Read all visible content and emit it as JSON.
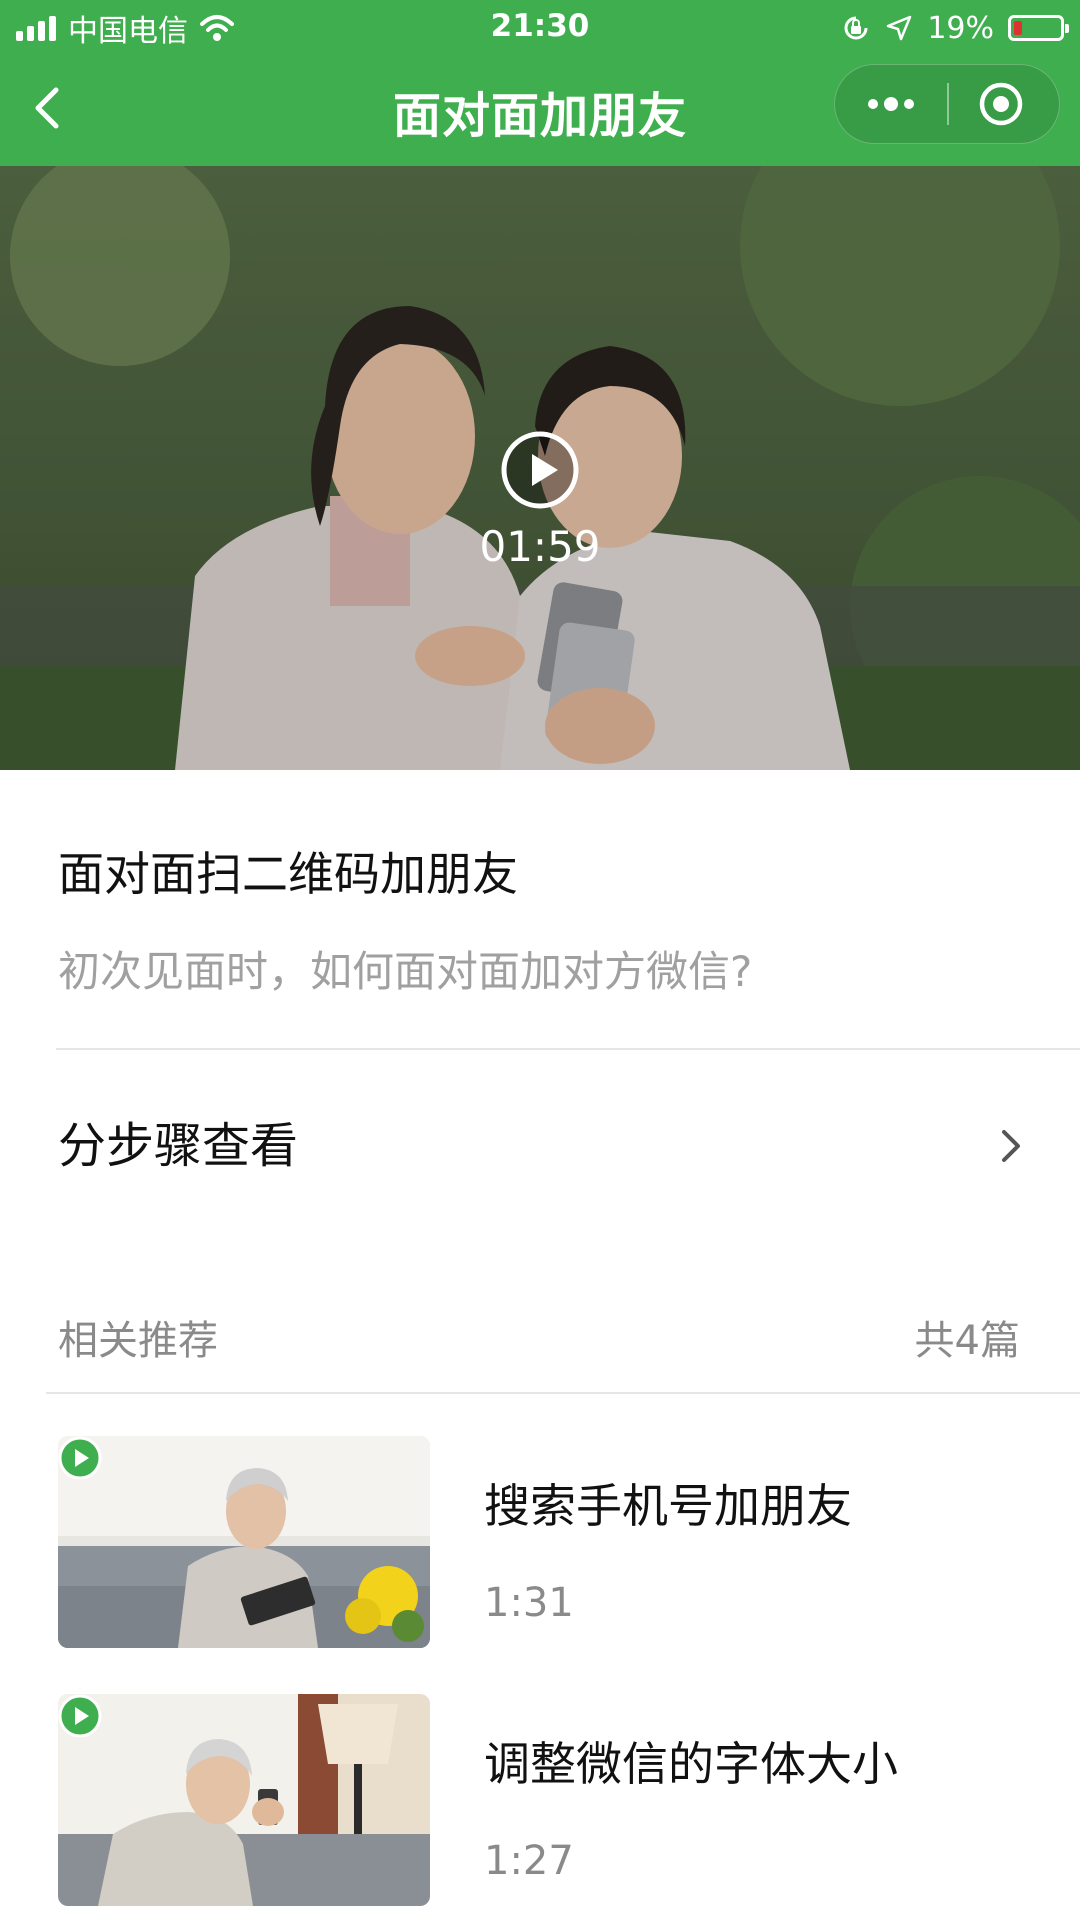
{
  "status_bar": {
    "carrier": "中国电信",
    "time": "21:30",
    "battery_percent": "19%",
    "battery_level": 0.19,
    "icons": [
      "signal-icon",
      "wifi-icon",
      "rotation-lock-icon",
      "location-arrow-icon",
      "battery-icon"
    ]
  },
  "nav": {
    "title": "面对面加朋友",
    "back_icon": "chevron-left-icon",
    "more_icon": "more-dots-icon",
    "close_icon": "target-close-icon"
  },
  "video": {
    "duration": "01:59",
    "play_icon": "play-icon"
  },
  "article": {
    "title": "面对面扫二维码加朋友",
    "subtitle": "初次见面时，如何面对面加对方微信?"
  },
  "steps": {
    "label": "分步骤查看",
    "chevron_icon": "chevron-right-icon"
  },
  "recommend": {
    "title": "相关推荐",
    "count": "共4篇",
    "items": [
      {
        "title": "搜索手机号加朋友",
        "duration": "1:31"
      },
      {
        "title": "调整微信的字体大小",
        "duration": "1:27"
      }
    ]
  },
  "colors": {
    "brand_green": "#3fae4e",
    "text_primary": "#111111",
    "text_secondary": "#8a8a8a",
    "battery_low": "#e03030"
  }
}
